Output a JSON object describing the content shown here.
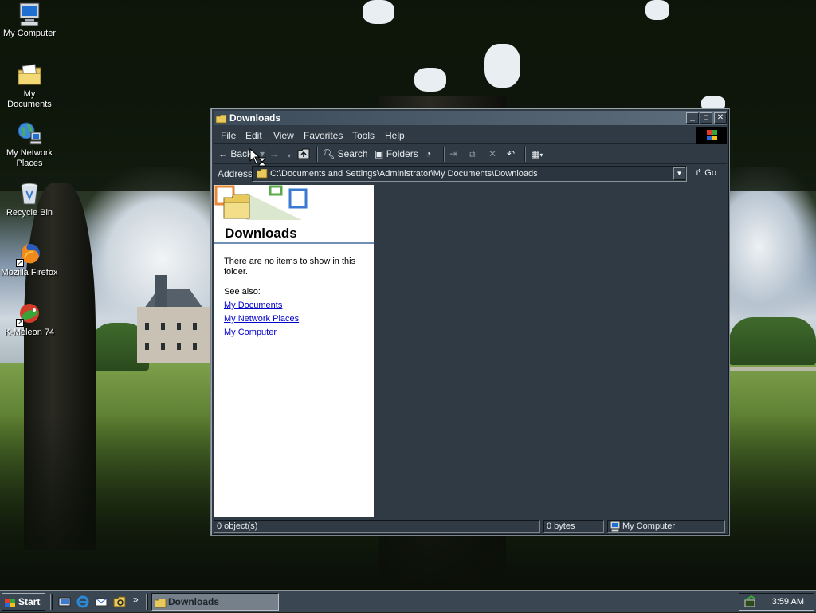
{
  "desktop": {
    "icons": [
      {
        "label": "My Computer",
        "icon": "my-computer-icon"
      },
      {
        "label": "My Documents",
        "icon": "my-documents-icon"
      },
      {
        "label": "My Network Places",
        "icon": "network-places-icon"
      },
      {
        "label": "Recycle Bin",
        "icon": "recycle-bin-icon"
      },
      {
        "label": "Mozilla Firefox",
        "icon": "firefox-icon"
      },
      {
        "label": "K-Meleon 74",
        "icon": "k-meleon-icon"
      }
    ]
  },
  "window": {
    "title": "Downloads",
    "menu": [
      "File",
      "Edit",
      "View",
      "Favorites",
      "Tools",
      "Help"
    ],
    "toolbar": {
      "back": "Back",
      "search": "Search",
      "folders": "Folders"
    },
    "address": {
      "label": "Address",
      "value": "C:\\Documents and Settings\\Administrator\\My Documents\\Downloads",
      "go": "Go"
    },
    "taskpane": {
      "title": "Downloads",
      "empty_message": "There are no items to show in this folder.",
      "see_also": "See also:",
      "links": [
        "My Documents",
        "My Network Places",
        "My Computer"
      ]
    },
    "status": {
      "objects": "0 object(s)",
      "size": "0 bytes",
      "location": "My Computer"
    }
  },
  "taskbar": {
    "start": "Start",
    "task": "Downloads",
    "clock": "3:59 AM",
    "chevron": "»"
  },
  "colors": {
    "window_bg": "#2f3a44",
    "titlebar": "#3c4b5a",
    "link": "#0000cc",
    "accent_line": "#6f8fb5"
  }
}
